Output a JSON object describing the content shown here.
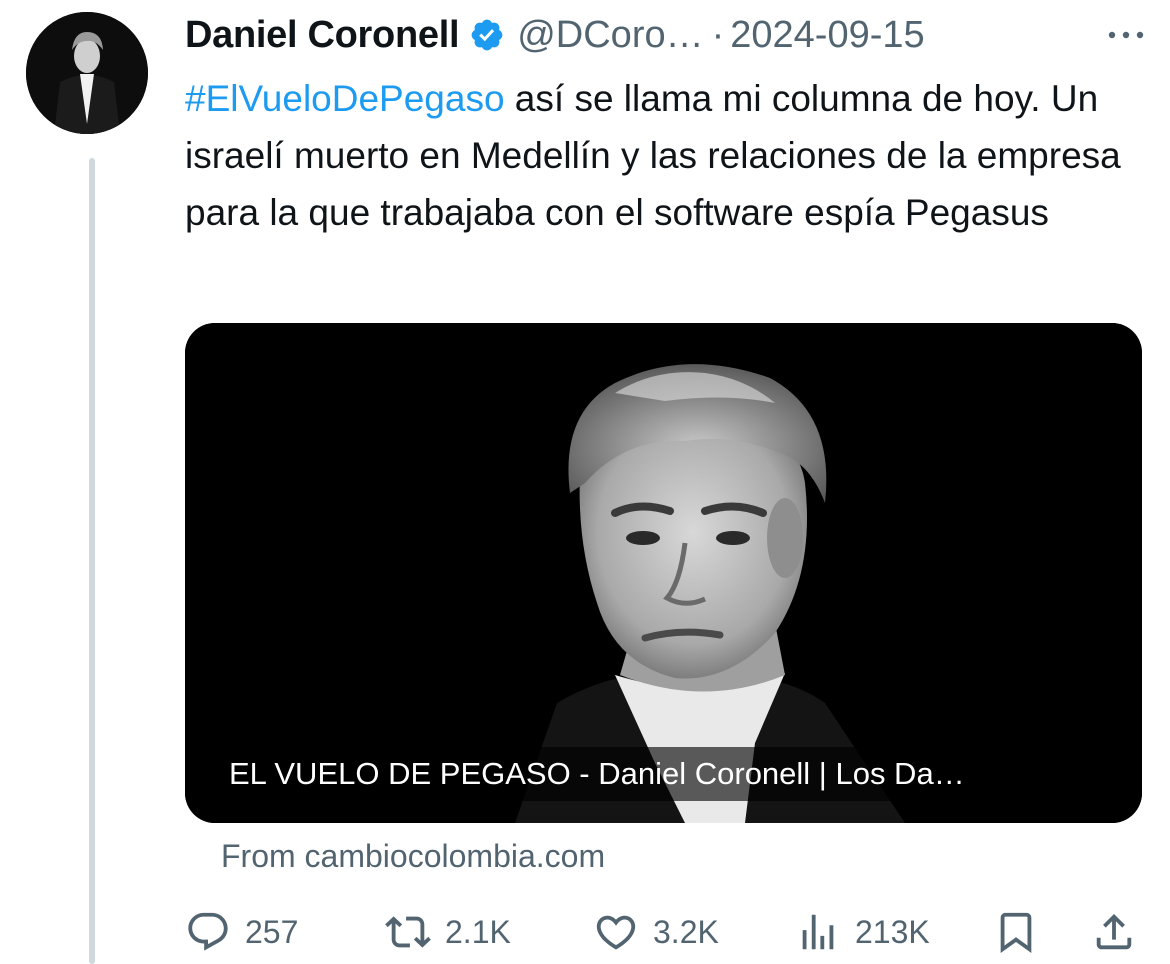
{
  "author": {
    "name": "Daniel Coronell",
    "handle": "@DCoro…",
    "separator": "·",
    "date": "2024-09-15",
    "verified": true
  },
  "tweet": {
    "hashtag": "#ElVueloDePegaso",
    "body": " así se llama mi columna de hoy. Un israelí muerto en Medellín y las relaciones de la empresa para la que trabajaba con el software espía Pegasus"
  },
  "card": {
    "title": "EL VUELO DE PEGASO - Daniel Coronell | Los Da…",
    "source": "From cambiocolombia.com"
  },
  "actions": {
    "replies": "257",
    "reposts": "2.1K",
    "likes": "3.2K",
    "views": "213K"
  },
  "icons": {
    "verified": "verified-badge-icon",
    "more": "more-dots-icon",
    "reply": "reply-icon",
    "repost": "repost-icon",
    "like": "heart-icon",
    "views": "views-chart-icon",
    "bookmark": "bookmark-icon",
    "share": "share-icon"
  },
  "colors": {
    "link": "#1d9bf0",
    "secondary_text": "#536471",
    "primary_text": "#0f1419",
    "thread_line": "#cfd9de"
  }
}
